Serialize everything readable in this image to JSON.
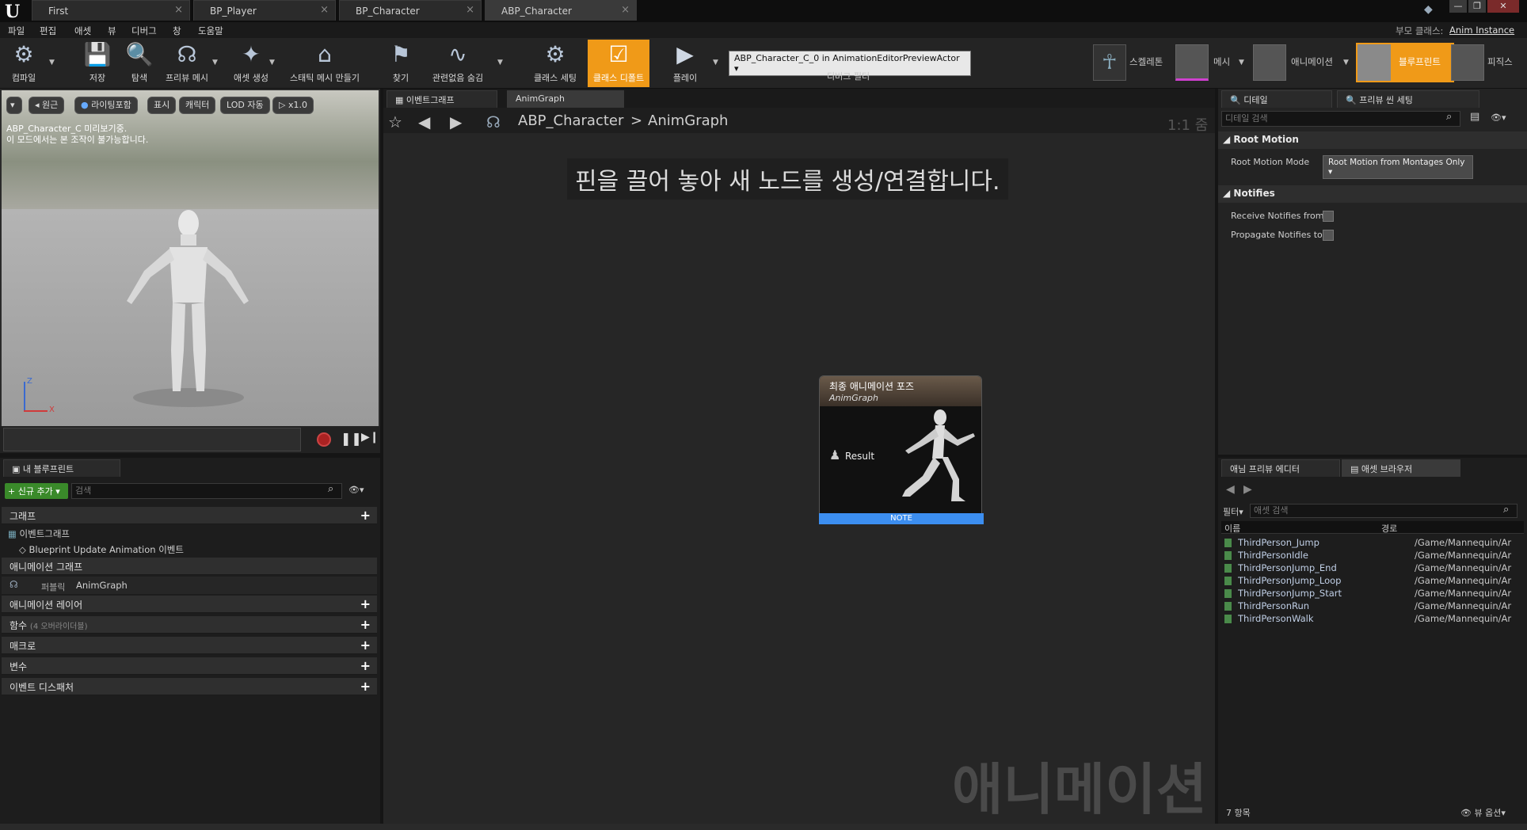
{
  "window": {
    "logo": "U",
    "tabs": [
      {
        "label": "First"
      },
      {
        "label": "BP_Player"
      },
      {
        "label": "BP_Character"
      },
      {
        "label": "ABP_Character"
      }
    ],
    "parent_class_label": "부모 클래스:",
    "parent_class_value": "Anim Instance"
  },
  "menu": [
    "파일",
    "편집",
    "애셋",
    "뷰",
    "디버그",
    "창",
    "도움말"
  ],
  "toolbar": {
    "buttons": [
      "컴파일",
      "저장",
      "탐색",
      "프리뷰 메시",
      "애셋 생성",
      "스태틱 메시 만들기",
      "찾기",
      "관련없음 숨김",
      "클래스 세팅",
      "클래스 디폴트",
      "플레이"
    ],
    "debug_dropdown": "ABP_Character_C_0 in AnimationEditorPreviewActor",
    "debug_filter": "디버그 필터",
    "modes": [
      "스켈레톤",
      "메시",
      "애니메이션",
      "블루프린트",
      "피직스"
    ]
  },
  "viewport": {
    "buttons": [
      "원근",
      "라이팅포함",
      "표시",
      "캐릭터",
      "LOD 자동",
      "x1.0"
    ],
    "info_line1": "ABP_Character_C 미리보기중.",
    "info_line2": "이 모드에서는 본 조작이 불가능합니다.",
    "axis_z": "Z",
    "axis_x": "X"
  },
  "myblueprint": {
    "tab": "내 블루프린트",
    "add_new": "+ 신규 추가",
    "search_placeholder": "검색",
    "graph_section": "그래프",
    "event_graph": "이벤트그래프",
    "bp_update": "Blueprint Update Animation 이벤트",
    "anim_graph_section": "애니메이션 그래프",
    "public": "퍼블릭",
    "anim_graph": "AnimGraph",
    "sections": [
      "애니메이션 레이어",
      "함수",
      "매크로",
      "변수",
      "이벤트 디스패처"
    ],
    "func_sub": "(4 오버라이더블)"
  },
  "graph": {
    "tabs": [
      "이벤트그래프",
      "AnimGraph"
    ],
    "breadcrumb_root": "ABP_Character",
    "breadcrumb_sep": ">",
    "breadcrumb_leaf": "AnimGraph",
    "zoom": "1:1 줌",
    "hint": "핀을 끌어 놓아 새 노드를 생성/연결합니다.",
    "node_title": "최종 애니메이션 포즈",
    "node_sub": "AnimGraph",
    "node_pin": "Result",
    "note": "NOTE",
    "watermark": "애니메이션"
  },
  "details": {
    "tabs": [
      "디테일",
      "프리뷰 씬 세팅"
    ],
    "search_placeholder": "디테일 검색",
    "root_motion": "Root Motion",
    "root_motion_mode_label": "Root Motion Mode",
    "root_motion_mode_value": "Root Motion from Montages Only",
    "notifies": "Notifies",
    "receive_notifies": "Receive Notifies from",
    "propagate_notifies": "Propagate Notifies to"
  },
  "asset_browser": {
    "tabs": [
      "애님 프리뷰 에디터",
      "애셋 브라우저"
    ],
    "filter": "필터",
    "search_placeholder": "애셋 검색",
    "col_name": "이름",
    "col_path": "경로",
    "items": [
      {
        "name": "ThirdPerson_Jump",
        "path": "/Game/Mannequin/Ar"
      },
      {
        "name": "ThirdPersonIdle",
        "path": "/Game/Mannequin/Ar"
      },
      {
        "name": "ThirdPersonJump_End",
        "path": "/Game/Mannequin/Ar"
      },
      {
        "name": "ThirdPersonJump_Loop",
        "path": "/Game/Mannequin/Ar"
      },
      {
        "name": "ThirdPersonJump_Start",
        "path": "/Game/Mannequin/Ar"
      },
      {
        "name": "ThirdPersonRun",
        "path": "/Game/Mannequin/Ar"
      },
      {
        "name": "ThirdPersonWalk",
        "path": "/Game/Mannequin/Ar"
      }
    ],
    "count": "7 항목",
    "view_options": "뷰 옵션"
  }
}
